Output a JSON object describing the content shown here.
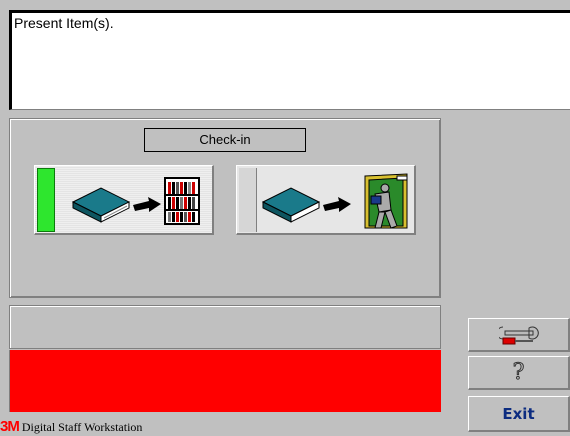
{
  "message": {
    "text": "Present Item(s)."
  },
  "mode": {
    "label": "Check-in"
  },
  "buttons": {
    "checkin": {
      "icon": "book-to-shelf-icon",
      "active": true
    },
    "checkout": {
      "icon": "book-out-door-icon",
      "active": false
    },
    "tools": {
      "icon": "wrench-screwdriver-icon"
    },
    "help": {
      "icon": "question-mark-icon",
      "glyph": "?"
    },
    "exit": {
      "label": "Exit"
    }
  },
  "status": {
    "alert_color": "#ff0000",
    "active_indicator_color": "#2ee62e"
  },
  "branding": {
    "logo": "3M",
    "product": "Digital Staff Workstation"
  }
}
